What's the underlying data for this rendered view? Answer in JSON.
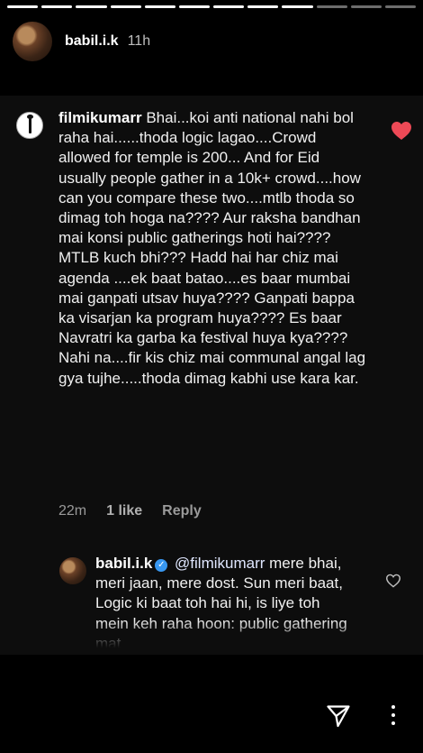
{
  "story": {
    "username": "babil.i.k",
    "time": "11h",
    "progress_segments_filled": 9,
    "progress_segments_total": 12
  },
  "comment": {
    "username": "filmikumarr",
    "text": "Bhai...koi anti national nahi bol raha hai......thoda logic lagao....Crowd allowed for temple is 200... And for Eid usually people gather in a 10k+ crowd....how can you compare these two....mtlb thoda so dimag toh hoga na???? Aur raksha bandhan mai konsi public gatherings hoti hai???? MTLB kuch bhi??? Hadd hai har chiz mai agenda ....ek baat batao....es baar mumbai mai ganpati utsav huya???? Ganpati bappa ka visarjan ka program huya???? Es baar Navratri ka garba ka festival huya kya???? Nahi na....fir kis chiz mai communal angal lag gya tujhe.....thoda dimag kabhi use kara kar.",
    "time": "22m",
    "likes": "1 like",
    "reply_label": "Reply",
    "liked": true,
    "heart_color": "#ed4956"
  },
  "reply": {
    "username": "babil.i.k",
    "verified": true,
    "mention": "@filmikumarr",
    "text": "mere bhai, meri jaan, mere dost. Sun meri baat, Logic ki baat toh hai hi, is liye toh mein keh raha hoon: public gathering mat"
  },
  "footer": {
    "icons": [
      "send-icon",
      "more-icon"
    ]
  },
  "colors": {
    "background": "#000000",
    "panel": "#0d0d0d",
    "verified": "#3897f0"
  }
}
